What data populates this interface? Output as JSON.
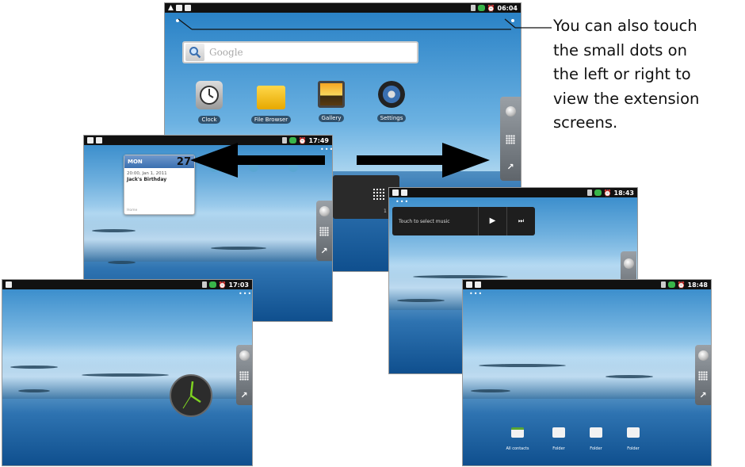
{
  "caption": [
    "You can also touch",
    "the small dots on",
    "the left or right to",
    "view the extension",
    "screens."
  ],
  "screens": {
    "top": {
      "time": "06:04",
      "search_placeholder": "Google",
      "apps": [
        {
          "label": "Clock"
        },
        {
          "label": "File Browser"
        },
        {
          "label": "Gallery"
        },
        {
          "label": "Settings"
        }
      ],
      "page_indicator": "1 of"
    },
    "left_mid": {
      "time": "17:49",
      "calendar": {
        "day": "MON",
        "date": "27",
        "event_time": "20:00, Jan 1, 2011",
        "event_title": "Jack's Birthday",
        "footer": "Home"
      }
    },
    "right_mid": {
      "time": "18:43",
      "music_prompt": "Touch to select music"
    },
    "left_bottom": {
      "time": "17:03"
    },
    "right_bottom": {
      "time": "18:48",
      "folders": [
        {
          "label": "All contacts"
        },
        {
          "label": "Folder"
        },
        {
          "label": "Folder"
        },
        {
          "label": "Folder"
        }
      ]
    }
  },
  "colors": {
    "accent": "#3a6fb0",
    "folder": "#f6c30f",
    "clock_face": "#2c2c2c",
    "clock_hands": "#7ed321"
  },
  "icons": {
    "status_left": [
      "warning-icon",
      "usb-icon",
      "sd-card-icon"
    ],
    "status_right": [
      "battery-icon",
      "signal-icon",
      "alarm-icon"
    ]
  }
}
